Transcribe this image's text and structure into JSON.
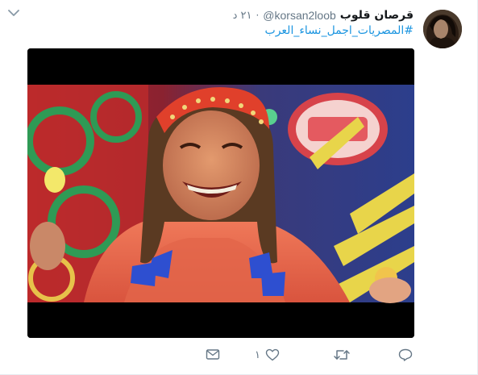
{
  "tweet": {
    "display_name": "قرصان قلوب",
    "handle": "@korsan2loob",
    "separator": "·",
    "timestamp": "٢١ د",
    "hashtag": "#المصريات_اجمل_نساء_العرب"
  },
  "actions": {
    "reply_count": "",
    "retweet_count": "",
    "like_count": "١"
  },
  "icons": {
    "caret": "chevron-down-icon",
    "reply": "reply-icon",
    "retweet": "retweet-icon",
    "like": "heart-icon",
    "message": "mail-icon"
  },
  "colors": {
    "name": "#14171a",
    "meta": "#657786",
    "link": "#1b95e0"
  }
}
